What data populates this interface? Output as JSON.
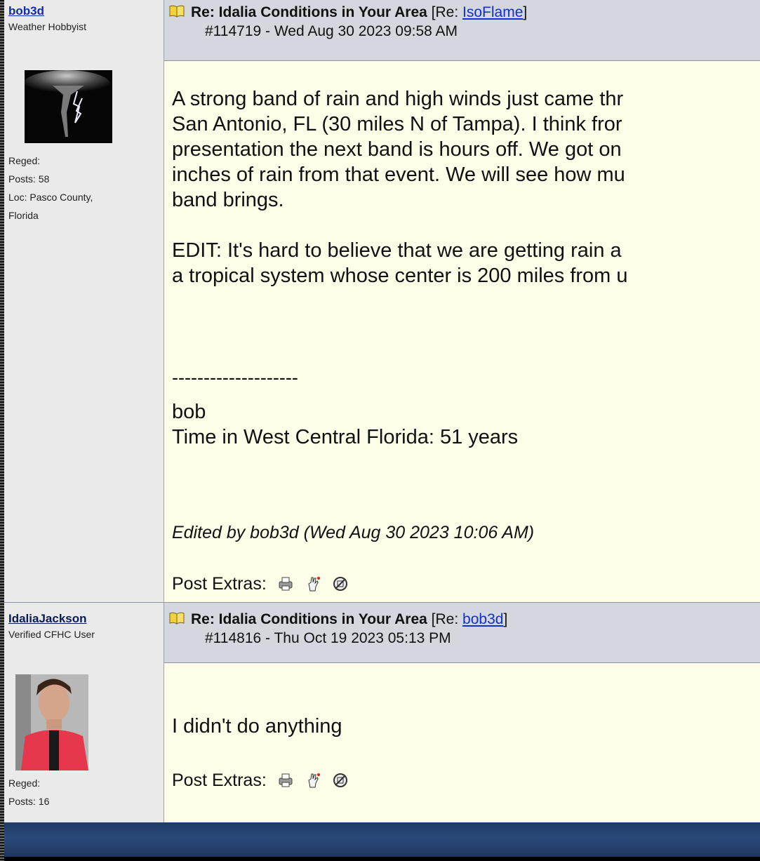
{
  "posts": [
    {
      "username": "bob3d",
      "user_title": "Weather Hobbyist",
      "reged_label": "Reged:",
      "posts_label": "Posts: 58",
      "loc_line1": "Loc: Pasco County,",
      "loc_line2": "Florida",
      "subject": "Re: Idalia Conditions in Your Area",
      "re_prefix": "[Re: ",
      "re_user": "IsoFlame",
      "re_suffix": "]",
      "post_id_line": "#114719 - Wed Aug 30 2023 09:58 AM",
      "body_lines": [
        "A strong band of rain and high winds just came thr",
        "San Antonio, FL (30 miles N of Tampa). I think fror",
        "presentation the next band is hours off. We got on",
        "inches of rain from that event. We will see how mu",
        "band brings."
      ],
      "edit_lines": [
        "EDIT: It's hard to believe that we are getting rain a",
        "a tropical system whose center is 200 miles from u"
      ],
      "signature_rule": "--------------------",
      "signature_lines": [
        "bob",
        "Time in West Central Florida: 51 years"
      ],
      "edited_note": "Edited by bob3d (Wed Aug 30 2023 10:06 AM)",
      "extras_label": "Post Extras:"
    },
    {
      "username": "IdaliaJackson",
      "user_title": "Verified CFHC User",
      "reged_label": "Reged:",
      "posts_label": "Posts: 16",
      "subject": "Re: Idalia Conditions in Your Area",
      "re_prefix": "[Re: ",
      "re_user": "bob3d",
      "re_suffix": "]",
      "post_id_line": "#114816 - Thu Oct 19 2023 05:13 PM",
      "body_lines": [
        "I didn't do anything"
      ],
      "extras_label": "Post Extras:"
    }
  ],
  "icons": {
    "subject": "book-icon",
    "extras": [
      "print-icon",
      "notify-moderator-icon",
      "ignore-icon"
    ]
  },
  "colors": {
    "link": "#1030d0",
    "header_bg": "#d5d7df",
    "body_bg": "#fffee8",
    "sidebar_bg": "#eaeaea"
  }
}
